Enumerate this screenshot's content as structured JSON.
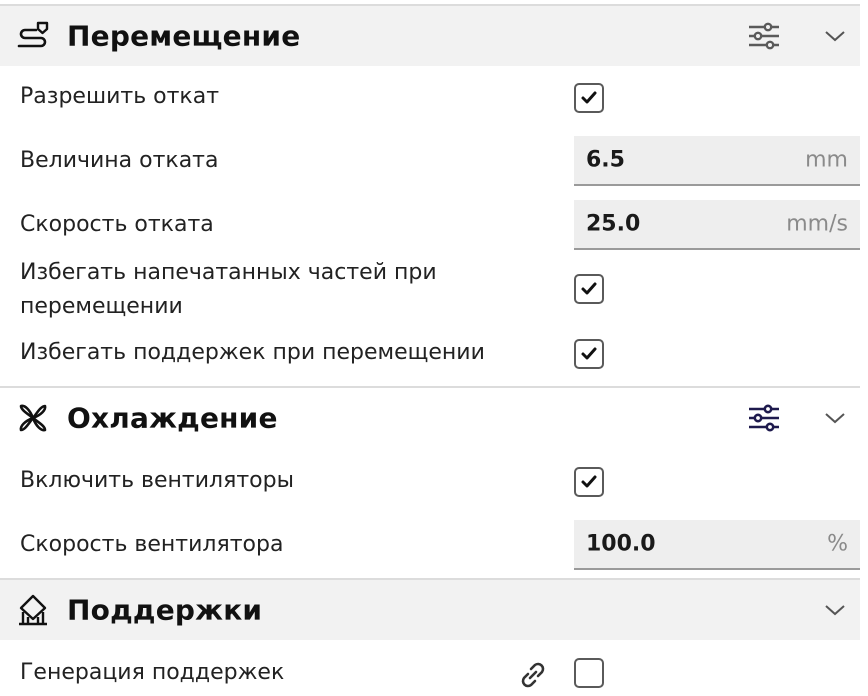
{
  "sections": {
    "travel": {
      "title": "Перемещение",
      "icon": "travel-icon",
      "settings": [
        {
          "label": "Разрешить откат",
          "type": "checkbox",
          "checked": true
        },
        {
          "label": "Величина отката",
          "type": "number",
          "value": "6.5",
          "unit": "mm"
        },
        {
          "label": "Скорость отката",
          "type": "number",
          "value": "25.0",
          "unit": "mm/s"
        },
        {
          "label_line1": "Избегать напечатанных частей при",
          "label_line2": "перемещении",
          "type": "checkbox",
          "checked": true
        },
        {
          "label": "Избегать поддержек при перемещении",
          "type": "checkbox",
          "checked": true
        }
      ]
    },
    "cooling": {
      "title": "Охлаждение",
      "icon": "fan-icon",
      "settings": [
        {
          "label": "Включить вентиляторы",
          "type": "checkbox",
          "checked": true
        },
        {
          "label": "Скорость вентилятора",
          "type": "number",
          "value": "100.0",
          "unit": "%"
        }
      ]
    },
    "support": {
      "title": "Поддержки",
      "icon": "support-icon",
      "settings": [
        {
          "label": "Генерация поддержек",
          "type": "checkbox",
          "checked": false
        }
      ]
    }
  },
  "colors": {
    "settings_icon_active": "#1e1a4d",
    "settings_icon_inactive": "#5a5a5a",
    "header_shaded_bg": "#f2f2f2",
    "field_bg": "#eeeeee"
  }
}
